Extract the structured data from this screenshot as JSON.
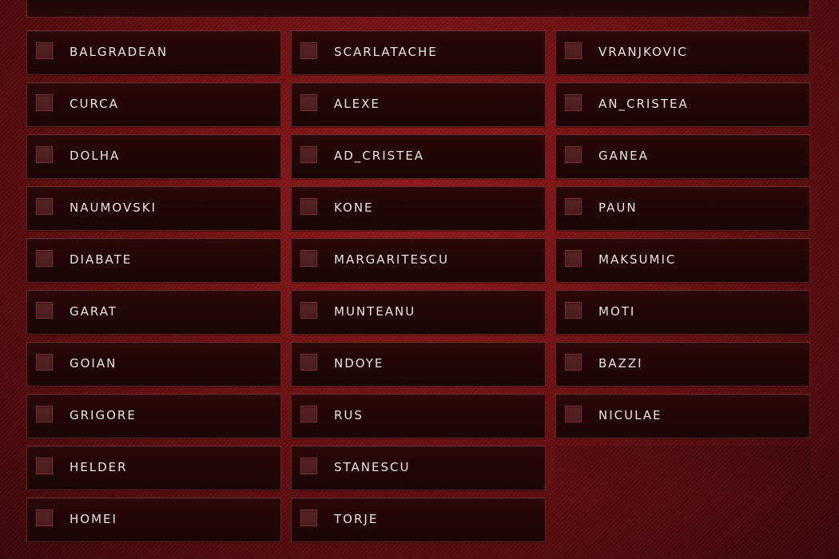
{
  "players": {
    "col1": [
      {
        "name": "BALGRADEAN"
      },
      {
        "name": "CURCA"
      },
      {
        "name": "DOLHA"
      },
      {
        "name": "NAUMOVSKI"
      },
      {
        "name": "DIABATE"
      },
      {
        "name": "GARAT"
      },
      {
        "name": "GOIAN"
      },
      {
        "name": "GRIGORE"
      },
      {
        "name": "HELDER"
      },
      {
        "name": "HOMEI"
      }
    ],
    "col2": [
      {
        "name": "SCARLATACHE"
      },
      {
        "name": "ALEXE"
      },
      {
        "name": "AD_CRISTEA"
      },
      {
        "name": "KONE"
      },
      {
        "name": "MARGARITESCU"
      },
      {
        "name": "MUNTEANU"
      },
      {
        "name": "NDOYE"
      },
      {
        "name": "RUS"
      },
      {
        "name": "STANESCU"
      },
      {
        "name": "TORJE"
      }
    ],
    "col3": [
      {
        "name": "VRANJKOVIC"
      },
      {
        "name": "AN_CRISTEA"
      },
      {
        "name": "GANEA"
      },
      {
        "name": "PAUN"
      },
      {
        "name": "MAKSUMIC"
      },
      {
        "name": "MOTI"
      },
      {
        "name": "BAZZI"
      },
      {
        "name": "NICULAE"
      }
    ]
  },
  "colors": {
    "background": "#6a1012",
    "card": "#220607",
    "card_border": "#5e2325",
    "checkbox": "#4a1c1e",
    "text": "#e9e4e4"
  }
}
